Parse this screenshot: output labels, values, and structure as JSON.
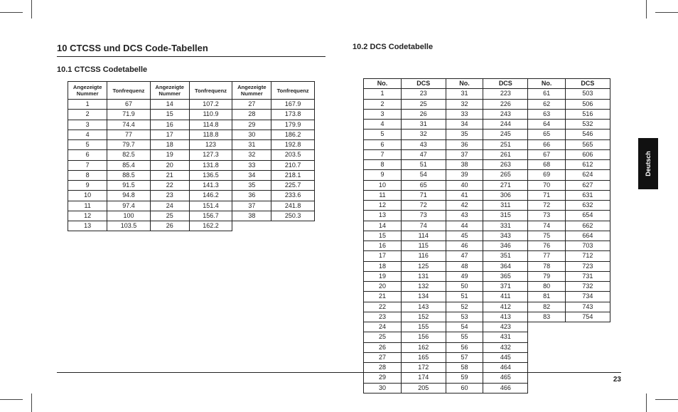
{
  "lang_tab": "Deutsch",
  "page_number": "23",
  "left": {
    "section_title": "10  CTCSS und DCS Code-Tabellen",
    "subsection_title": "10.1 CTCSS Codetabelle",
    "headers": [
      "Angezeigte Nummer",
      "Tonfrequenz",
      "Angezeigte Nummer",
      "Tonfrequenz",
      "Angezeigte Nummer",
      "Tonfrequenz"
    ],
    "rows": [
      [
        "1",
        "67",
        "14",
        "107.2",
        "27",
        "167.9"
      ],
      [
        "2",
        "71.9",
        "15",
        "110.9",
        "28",
        "173.8"
      ],
      [
        "3",
        "74.4",
        "16",
        "114.8",
        "29",
        "179.9"
      ],
      [
        "4",
        "77",
        "17",
        "118.8",
        "30",
        "186.2"
      ],
      [
        "5",
        "79.7",
        "18",
        "123",
        "31",
        "192.8"
      ],
      [
        "6",
        "82.5",
        "19",
        "127.3",
        "32",
        "203.5"
      ],
      [
        "7",
        "85.4",
        "20",
        "131.8",
        "33",
        "210.7"
      ],
      [
        "8",
        "88.5",
        "21",
        "136.5",
        "34",
        "218.1"
      ],
      [
        "9",
        "91.5",
        "22",
        "141.3",
        "35",
        "225.7"
      ],
      [
        "10",
        "94.8",
        "23",
        "146.2",
        "36",
        "233.6"
      ],
      [
        "11",
        "97.4",
        "24",
        "151.4",
        "37",
        "241.8"
      ],
      [
        "12",
        "100",
        "25",
        "156.7",
        "38",
        "250.3"
      ],
      [
        "13",
        "103.5",
        "26",
        "162.2",
        "",
        ""
      ]
    ]
  },
  "right": {
    "subsection_title": "10.2 DCS Codetabelle",
    "headers": [
      "No.",
      "DCS",
      "No.",
      "DCS",
      "No.",
      "DCS"
    ],
    "rows": [
      [
        "1",
        "23",
        "31",
        "223",
        "61",
        "503"
      ],
      [
        "2",
        "25",
        "32",
        "226",
        "62",
        "506"
      ],
      [
        "3",
        "26",
        "33",
        "243",
        "63",
        "516"
      ],
      [
        "4",
        "31",
        "34",
        "244",
        "64",
        "532"
      ],
      [
        "5",
        "32",
        "35",
        "245",
        "65",
        "546"
      ],
      [
        "6",
        "43",
        "36",
        "251",
        "66",
        "565"
      ],
      [
        "7",
        "47",
        "37",
        "261",
        "67",
        "606"
      ],
      [
        "8",
        "51",
        "38",
        "263",
        "68",
        "612"
      ],
      [
        "9",
        "54",
        "39",
        "265",
        "69",
        "624"
      ],
      [
        "10",
        "65",
        "40",
        "271",
        "70",
        "627"
      ],
      [
        "11",
        "71",
        "41",
        "306",
        "71",
        "631"
      ],
      [
        "12",
        "72",
        "42",
        "311",
        "72",
        "632"
      ],
      [
        "13",
        "73",
        "43",
        "315",
        "73",
        "654"
      ],
      [
        "14",
        "74",
        "44",
        "331",
        "74",
        "662"
      ],
      [
        "15",
        "114",
        "45",
        "343",
        "75",
        "664"
      ],
      [
        "16",
        "115",
        "46",
        "346",
        "76",
        "703"
      ],
      [
        "17",
        "116",
        "47",
        "351",
        "77",
        "712"
      ],
      [
        "18",
        "125",
        "48",
        "364",
        "78",
        "723"
      ],
      [
        "19",
        "131",
        "49",
        "365",
        "79",
        "731"
      ],
      [
        "20",
        "132",
        "50",
        "371",
        "80",
        "732"
      ],
      [
        "21",
        "134",
        "51",
        "411",
        "81",
        "734"
      ],
      [
        "22",
        "143",
        "52",
        "412",
        "82",
        "743"
      ],
      [
        "23",
        "152",
        "53",
        "413",
        "83",
        "754"
      ],
      [
        "24",
        "155",
        "54",
        "423",
        "",
        ""
      ],
      [
        "25",
        "156",
        "55",
        "431",
        "",
        ""
      ],
      [
        "26",
        "162",
        "56",
        "432",
        "",
        ""
      ],
      [
        "27",
        "165",
        "57",
        "445",
        "",
        ""
      ],
      [
        "28",
        "172",
        "58",
        "464",
        "",
        ""
      ],
      [
        "29",
        "174",
        "59",
        "465",
        "",
        ""
      ],
      [
        "30",
        "205",
        "60",
        "466",
        "",
        ""
      ]
    ]
  }
}
